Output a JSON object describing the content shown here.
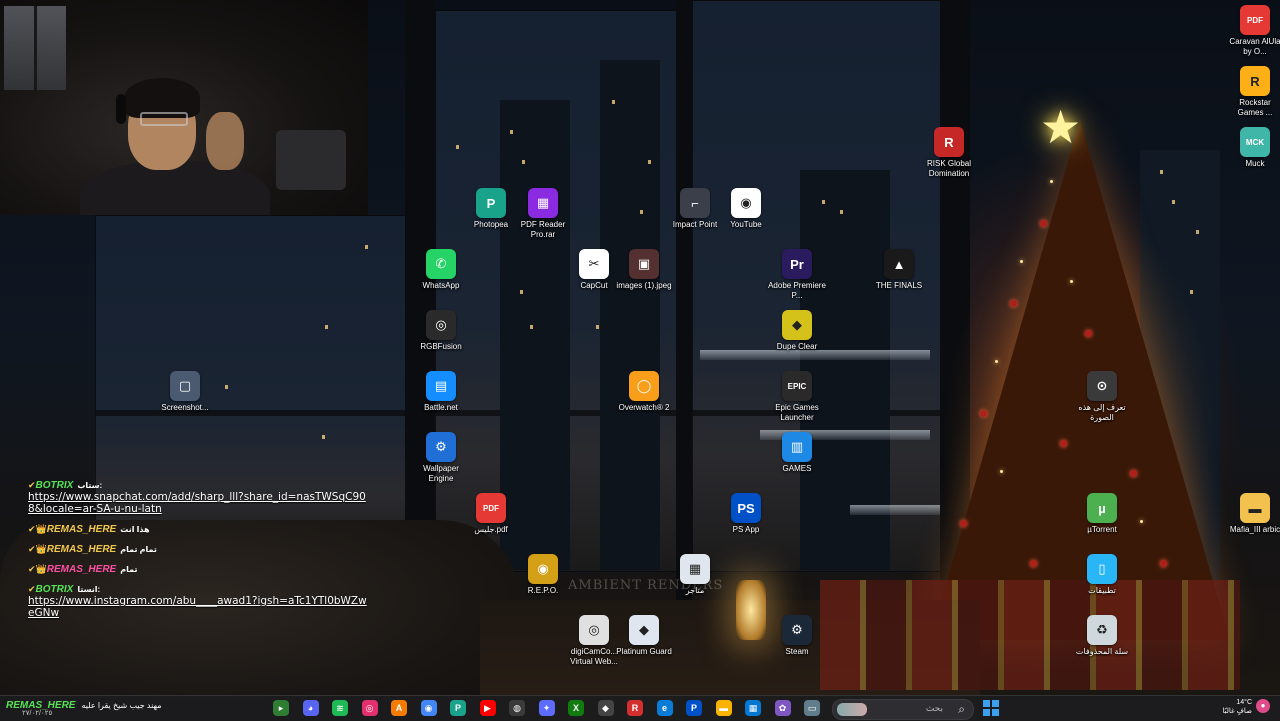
{
  "desktop_icons": [
    {
      "id": "photopea",
      "label": "Photopea",
      "color": "#18a38a",
      "glyph": "P",
      "icon": "photopea-icon"
    },
    {
      "id": "pdfreader",
      "label": "PDF Reader Pro.rar",
      "color": "#8a2be2",
      "glyph": "▦",
      "icon": "winrar-archive-icon"
    },
    {
      "id": "impactpoint",
      "label": "Impact Point",
      "color": "#3a3f4a",
      "glyph": "⌐",
      "icon": "impact-point-icon"
    },
    {
      "id": "youtube",
      "label": "YouTube",
      "color": "#ffffff",
      "glyph": "◉",
      "icon": "chrome-app-icon"
    },
    {
      "id": "whatsapp",
      "label": "WhatsApp",
      "color": "#25d366",
      "glyph": "✆",
      "icon": "whatsapp-icon"
    },
    {
      "id": "capcut",
      "label": "CapCut",
      "color": "#ffffff",
      "glyph": "✂",
      "icon": "capcut-icon"
    },
    {
      "id": "images",
      "label": "images (1).jpeg",
      "color": "#553030",
      "glyph": "▣",
      "icon": "image-file-icon"
    },
    {
      "id": "premiere",
      "label": "Adobe Premiere P...",
      "color": "#2a1a5e",
      "glyph": "Pr",
      "icon": "premiere-pro-icon"
    },
    {
      "id": "thefinals",
      "label": "THE FINALS",
      "color": "#1a1a1a",
      "glyph": "▲",
      "icon": "the-finals-icon"
    },
    {
      "id": "rgbfusion",
      "label": "RGBFusion",
      "color": "#2a2a2a",
      "glyph": "◎",
      "icon": "rgb-fusion-icon"
    },
    {
      "id": "dupeclear",
      "label": "Dupe Clear",
      "color": "#d4c21a",
      "glyph": "◆",
      "icon": "dupe-clear-icon"
    },
    {
      "id": "screenshot",
      "label": "Screenshot...",
      "color": "#4a5a70",
      "glyph": "▢",
      "icon": "screenshot-file-icon"
    },
    {
      "id": "battlenet",
      "label": "Battle.net",
      "color": "#148eff",
      "glyph": "▤",
      "icon": "battle-net-icon"
    },
    {
      "id": "overwatch",
      "label": "Overwatch® 2",
      "color": "#f99e1a",
      "glyph": "◯",
      "icon": "overwatch-icon"
    },
    {
      "id": "epic",
      "label": "Epic Games Launcher",
      "color": "#2a2a2a",
      "glyph": "EPIC",
      "icon": "epic-games-icon"
    },
    {
      "id": "wallpaperengine",
      "label": "Wallpaper Engine",
      "color": "#1f6fd6",
      "glyph": "⚙",
      "icon": "wallpaper-engine-icon"
    },
    {
      "id": "games",
      "label": "GAMES",
      "color": "#1e88e5",
      "glyph": "▥",
      "icon": "folder-icon"
    },
    {
      "id": "pdffile",
      "label": "جليس.pdf",
      "color": "#e53935",
      "glyph": "PDF",
      "icon": "pdf-file-icon"
    },
    {
      "id": "psapp",
      "label": "PS App",
      "color": "#0050c8",
      "glyph": "PS",
      "icon": "playstation-app-icon"
    },
    {
      "id": "repo",
      "label": "R.E.P.O.",
      "color": "#d4a017",
      "glyph": "◉",
      "icon": "repo-game-icon"
    },
    {
      "id": "store",
      "label": "متاجر",
      "color": "#dfe6ee",
      "glyph": "▦",
      "icon": "store-shortcut-icon"
    },
    {
      "id": "digicam",
      "label": "digiCamCo... Virtual Web...",
      "color": "#e0e0e0",
      "glyph": "◎",
      "icon": "digicam-webcam-icon"
    },
    {
      "id": "platinumguard",
      "label": "Platinum Guard",
      "color": "#dfe6f0",
      "glyph": "◆",
      "icon": "platinum-guard-icon"
    },
    {
      "id": "steam",
      "label": "Steam",
      "color": "#1b2838",
      "glyph": "⚙",
      "icon": "steam-icon"
    },
    {
      "id": "risk",
      "label": "RISK Global Domination",
      "color": "#c62828",
      "glyph": "R",
      "icon": "risk-game-icon"
    },
    {
      "id": "caravan",
      "label": "Caravan AlUla by O...",
      "color": "#e53935",
      "glyph": "PDF",
      "icon": "pdf-file-icon"
    },
    {
      "id": "rockstar",
      "label": "Rockstar Games ...",
      "color": "#fcaf17",
      "glyph": "R",
      "icon": "rockstar-launcher-icon"
    },
    {
      "id": "muck",
      "label": "Muck",
      "color": "#3fb6a8",
      "glyph": "MCK",
      "icon": "muck-game-icon"
    },
    {
      "id": "reverse",
      "label": "تعرف إلى هذه الصورة",
      "color": "#3a3a3a",
      "glyph": "⊙",
      "icon": "learn-about-picture-icon"
    },
    {
      "id": "utorrent",
      "label": "µTorrent",
      "color": "#4caf50",
      "glyph": "µ",
      "icon": "utorrent-icon"
    },
    {
      "id": "mafia",
      "label": "Mafia_III arbic",
      "color": "#f2c14e",
      "glyph": "▬",
      "icon": "folder-icon"
    },
    {
      "id": "apps",
      "label": "تطبيقات",
      "color": "#29b6f6",
      "glyph": "▯",
      "icon": "apps-folder-icon"
    },
    {
      "id": "recycle",
      "label": "سلة المحذوفات",
      "color": "#cfd8dc",
      "glyph": "♻",
      "icon": "recycle-bin-icon"
    }
  ],
  "watermark": "AMBIENT RENDERS",
  "chat": [
    {
      "user": "BOTRIX",
      "prefix": "ستاب:",
      "user_color": "#57e356",
      "badge": "✔",
      "text": "https://www.snapchat.com/add/sharp_lll?share_id=nasTWSqC908&locale=ar-SA-u-nu-latn",
      "is_link": true
    },
    {
      "user": "REMAS_HERE",
      "prefix": "هذا انت",
      "user_color": "#f2c94c",
      "badge": "✔👑",
      "text": "",
      "is_link": false
    },
    {
      "user": "REMAS_HERE",
      "prefix": "تمام تمام",
      "user_color": "#f2c94c",
      "badge": "✔👑",
      "text": "",
      "is_link": false
    },
    {
      "user": "REMAS_HERE",
      "prefix": "تمام",
      "user_color": "#ff4fa3",
      "badge": "✔👑",
      "text": "",
      "is_link": false
    },
    {
      "user": "BOTRIX",
      "prefix": "انستا:",
      "user_color": "#57e356",
      "badge": "✔",
      "text": "https://www.instagram.com/abu____awad1?igsh=aTc1YTl0bWZweGNw",
      "is_link": true
    }
  ],
  "taskbar": {
    "chat_user": "REMAS_HERE",
    "chat_text": "مهند جيب شيخ يقرا عليه",
    "date": "٢٧/٠٢/٠٢٥",
    "search_placeholder": "بحث",
    "weather_temp": "14°C",
    "weather_desc": "صافٍ غالبًا",
    "apps": [
      {
        "name": "terminal-icon",
        "glyph": "▸",
        "color": "#2e7d32"
      },
      {
        "name": "discord-icon",
        "glyph": "◕",
        "color": "#5865f2"
      },
      {
        "name": "spotify-icon",
        "glyph": "≋",
        "color": "#1db954"
      },
      {
        "name": "instagram-icon",
        "glyph": "◎",
        "color": "#e1306c"
      },
      {
        "name": "artstation-icon",
        "glyph": "A",
        "color": "#f57c00"
      },
      {
        "name": "chrome-icon",
        "glyph": "◉",
        "color": "#4285f4"
      },
      {
        "name": "photopea-icon",
        "glyph": "P",
        "color": "#18a38a"
      },
      {
        "name": "youtube-icon",
        "glyph": "▶",
        "color": "#ff0000"
      },
      {
        "name": "obs-icon",
        "glyph": "◍",
        "color": "#3a3a3a"
      },
      {
        "name": "rgb-icon",
        "glyph": "✦",
        "color": "#5b6cff"
      },
      {
        "name": "xbox-icon",
        "glyph": "X",
        "color": "#107c10"
      },
      {
        "name": "unity-icon",
        "glyph": "◆",
        "color": "#444"
      },
      {
        "name": "rockstar-icon",
        "glyph": "R",
        "color": "#d32f2f"
      },
      {
        "name": "edge-icon",
        "glyph": "e",
        "color": "#0b7cd6"
      },
      {
        "name": "playstation-icon",
        "glyph": "P",
        "color": "#0050c8"
      },
      {
        "name": "file-explorer-icon",
        "glyph": "▬",
        "color": "#f9b200"
      },
      {
        "name": "microsoft-store-icon",
        "glyph": "▦",
        "color": "#0078d4"
      },
      {
        "name": "copilot-icon",
        "glyph": "✿",
        "color": "#7e57c2"
      },
      {
        "name": "desktop-window-icon",
        "glyph": "▭",
        "color": "#607d8b"
      }
    ]
  }
}
